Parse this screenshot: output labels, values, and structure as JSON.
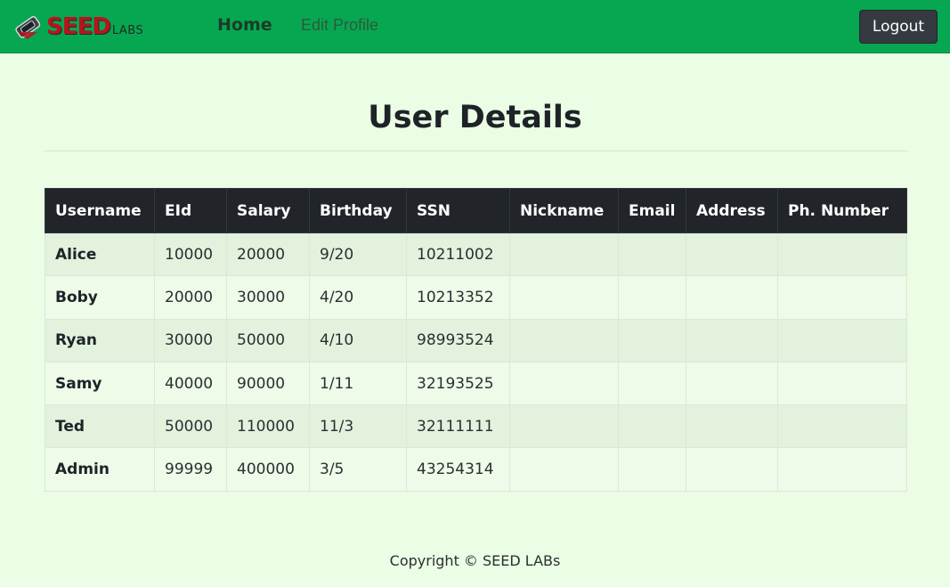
{
  "navbar": {
    "brand_seed": "SEED",
    "brand_labs": "LABS",
    "home_label": "Home",
    "edit_profile_label": "Edit Profile",
    "logout_label": "Logout"
  },
  "main": {
    "title": "User Details"
  },
  "table": {
    "headers": [
      "Username",
      "EId",
      "Salary",
      "Birthday",
      "SSN",
      "Nickname",
      "Email",
      "Address",
      "Ph. Number"
    ],
    "rows": [
      [
        "Alice",
        "10000",
        "20000",
        "9/20",
        "10211002",
        "",
        "",
        "",
        ""
      ],
      [
        "Boby",
        "20000",
        "30000",
        "4/20",
        "10213352",
        "",
        "",
        "",
        ""
      ],
      [
        "Ryan",
        "30000",
        "50000",
        "4/10",
        "98993524",
        "",
        "",
        "",
        ""
      ],
      [
        "Samy",
        "40000",
        "90000",
        "1/11",
        "32193525",
        "",
        "",
        "",
        ""
      ],
      [
        "Ted",
        "50000",
        "110000",
        "11/3",
        "32111111",
        "",
        "",
        "",
        ""
      ],
      [
        "Admin",
        "99999",
        "400000",
        "3/5",
        "43254314",
        "",
        "",
        "",
        ""
      ]
    ]
  },
  "footer": {
    "text": "Copyright © SEED LABs"
  },
  "colors": {
    "navbar_bg": "#07a752",
    "page_bg": "#ebfde4",
    "table_header_bg": "#212529",
    "logout_bg": "#343a40",
    "brand_red": "#b8141c"
  },
  "icons": {
    "brand_emblem": "seed-labs-logo-icon"
  }
}
